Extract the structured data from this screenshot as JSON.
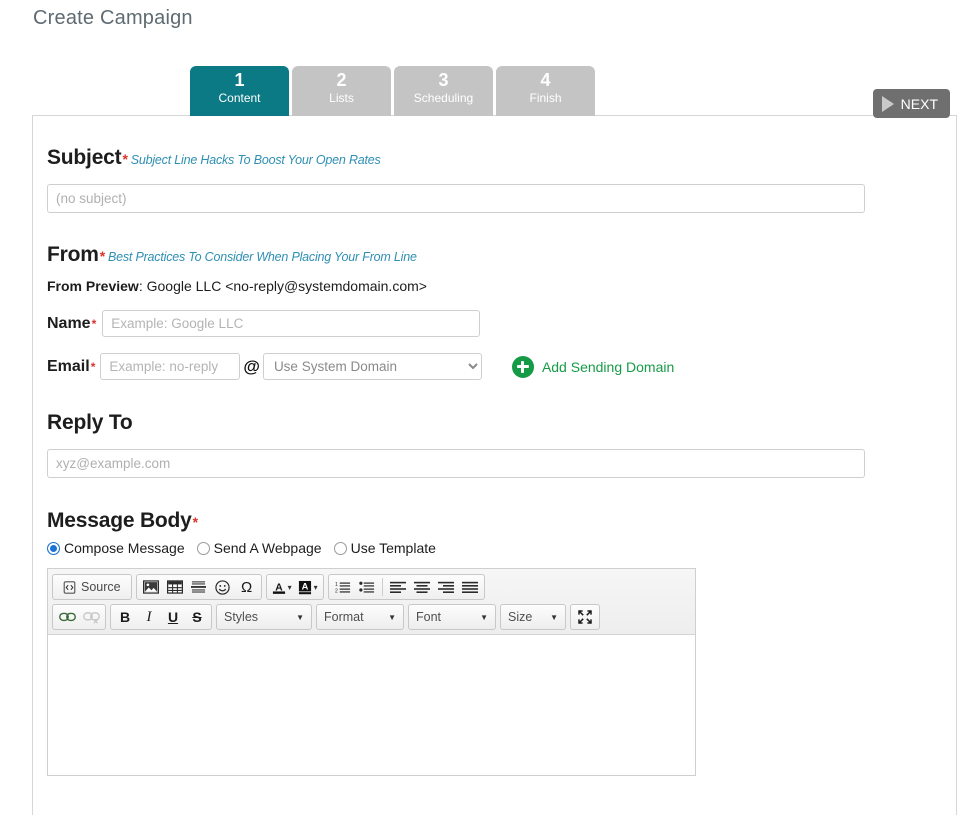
{
  "page": {
    "title": "Create Campaign"
  },
  "wizard": {
    "steps": [
      {
        "num": "1",
        "label": "Content",
        "active": true
      },
      {
        "num": "2",
        "label": "Lists",
        "active": false
      },
      {
        "num": "3",
        "label": "Scheduling",
        "active": false
      },
      {
        "num": "4",
        "label": "Finish",
        "active": false
      }
    ],
    "next_label": "NEXT",
    "active_color": "#0c7a85",
    "inactive_color": "#c4c4c4"
  },
  "subject": {
    "heading": "Subject",
    "required_mark": "*",
    "hint_link": "Subject Line Hacks To Boost Your Open Rates",
    "placeholder": "(no subject)",
    "value": ""
  },
  "from": {
    "heading": "From",
    "required_mark": "*",
    "hint_link": "Best Practices To Consider When Placing Your From Line",
    "preview_label": "From Preview",
    "preview_value": ": Google LLC <no-reply@systemdomain.com>",
    "name_label": "Name",
    "name_placeholder": "Example: Google LLC",
    "name_value": "",
    "email_label": "Email",
    "email_placeholder": "Example: no-reply",
    "email_value": "",
    "at_symbol": "@",
    "domain_selected": "Use System Domain",
    "domain_options": [
      "Use System Domain"
    ],
    "add_domain_label": "Add Sending Domain",
    "add_domain_color": "#179b48"
  },
  "reply_to": {
    "heading": "Reply To",
    "placeholder": "xyz@example.com",
    "value": ""
  },
  "message_body": {
    "heading": "Message Body",
    "required_mark": "*",
    "options": [
      {
        "label": "Compose Message",
        "checked": true
      },
      {
        "label": "Send A Webpage",
        "checked": false
      },
      {
        "label": "Use Template",
        "checked": false
      }
    ],
    "editor": {
      "source_label": "Source",
      "row1_icons": [
        "image-icon",
        "table-icon",
        "horizontal-rule-icon",
        "smiley-icon",
        "special-character-icon"
      ],
      "color_icons": [
        "text-color-icon",
        "background-color-icon"
      ],
      "list_icons": [
        "numbered-list-icon",
        "bulleted-list-icon"
      ],
      "align_icons": [
        "align-left-icon",
        "align-center-icon",
        "align-right-icon",
        "align-justify-icon"
      ],
      "link_icons": [
        "link-icon",
        "unlink-icon"
      ],
      "format_icons": [
        "bold-icon",
        "italic-icon",
        "underline-icon",
        "strikethrough-icon"
      ],
      "bold_label": "B",
      "italic_label": "I",
      "underline_label": "U",
      "strike_label": "S",
      "styles_label": "Styles",
      "format_label": "Format",
      "font_label": "Font",
      "size_label": "Size",
      "maximize_icon": "maximize-icon",
      "content": ""
    }
  }
}
